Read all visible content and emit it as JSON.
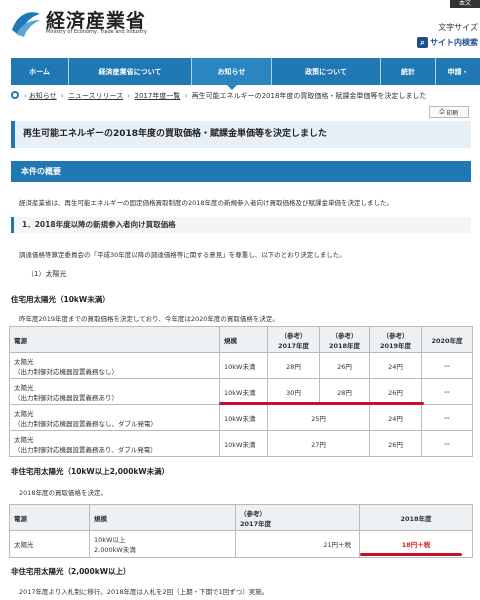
{
  "header": {
    "org_name": "経済産業省",
    "org_name_en": "Ministry of Economy, Trade and Industry",
    "top_tab": "本文",
    "font_size_label": "文字サイズ",
    "site_search": "サイト内検索"
  },
  "nav": {
    "items": [
      "ホーム",
      "経済産業省について",
      "お知らせ",
      "政策について",
      "統計",
      "申請・"
    ]
  },
  "breadcrumb": {
    "items": [
      "お知らせ",
      "ニュースリリース",
      "2017年度一覧"
    ],
    "current": "再生可能エネルギーの2018年度の買取価格・賦課金単価等を決定しました"
  },
  "print_label": "印刷",
  "page_title": "再生可能エネルギーの2018年度の買取価格・賦課金単価等を決定しました",
  "section_heading": "本件の概要",
  "intro_text": "経済産業省は、再生可能エネルギーの固定価格買取制度の2018年度の新規参入者向け買取価格及び賦課金単価を決定しました。",
  "sub_heading_1": "1．2018年度以降の新規参入者向け買取価格",
  "committee_text": "調達価格等算定委員会の「平成30年度以降の調達価格等に関する意見」を尊重し、以下のとおり決定しました。",
  "solar_heading": "（1）太陽光",
  "residential_heading": "住宅用太陽光（10kW未満）",
  "residential_text": "昨年度2019年度までの買取価格を決定しており、今年度は2020年度の買取価格を決定。",
  "table1": {
    "headers": [
      "電源",
      "規模",
      "（参考）\n2017年度",
      "（参考）\n2018年度",
      "（参考）\n2019年度",
      "2020年度"
    ],
    "rows": [
      {
        "source": "太陽光",
        "note": "（出力制御対応機器設置義務なし）",
        "scale": "10kW未満",
        "y2017": "28円",
        "y2018": "26円",
        "y2019": "24円",
        "y2020": "--"
      },
      {
        "source": "太陽光",
        "note": "（出力制御対応機器設置義務あり）",
        "scale": "10kW未満",
        "y2017": "30円",
        "y2018": "28円",
        "y2019": "26円",
        "y2020": "--"
      },
      {
        "source": "太陽光",
        "note": "（出力制御対応機器設置義務なし、ダブル発電）",
        "scale": "10kW未満",
        "merged": "25円",
        "y2019": "24円",
        "y2020": "--"
      },
      {
        "source": "太陽光",
        "note": "（出力制御対応機器設置義務あり、ダブル発電）",
        "scale": "10kW未満",
        "merged": "27円",
        "y2019": "26円",
        "y2020": "--"
      }
    ]
  },
  "nonres_heading": "非住宅用太陽光（10kW以上2,000kW未満）",
  "nonres_text": "2018年度の買取価格を決定。",
  "table2": {
    "headers": [
      "電源",
      "規模",
      "（参考）\n2017年度",
      "2018年度"
    ],
    "row": {
      "source": "太陽光",
      "scale_line1": "10kW以上",
      "scale_line2": "2,000kW未満",
      "y2017": "21円＋税",
      "y2018": "18円＋税"
    }
  },
  "large_heading": "非住宅用太陽光（2,000kW以上）",
  "large_text": "2017年度より入札制に移行。2018年度は入札を2回（上期・下期で1回ずつ）実施。",
  "colors": {
    "brand": "#1f78b4",
    "highlight": "#c8102e"
  }
}
